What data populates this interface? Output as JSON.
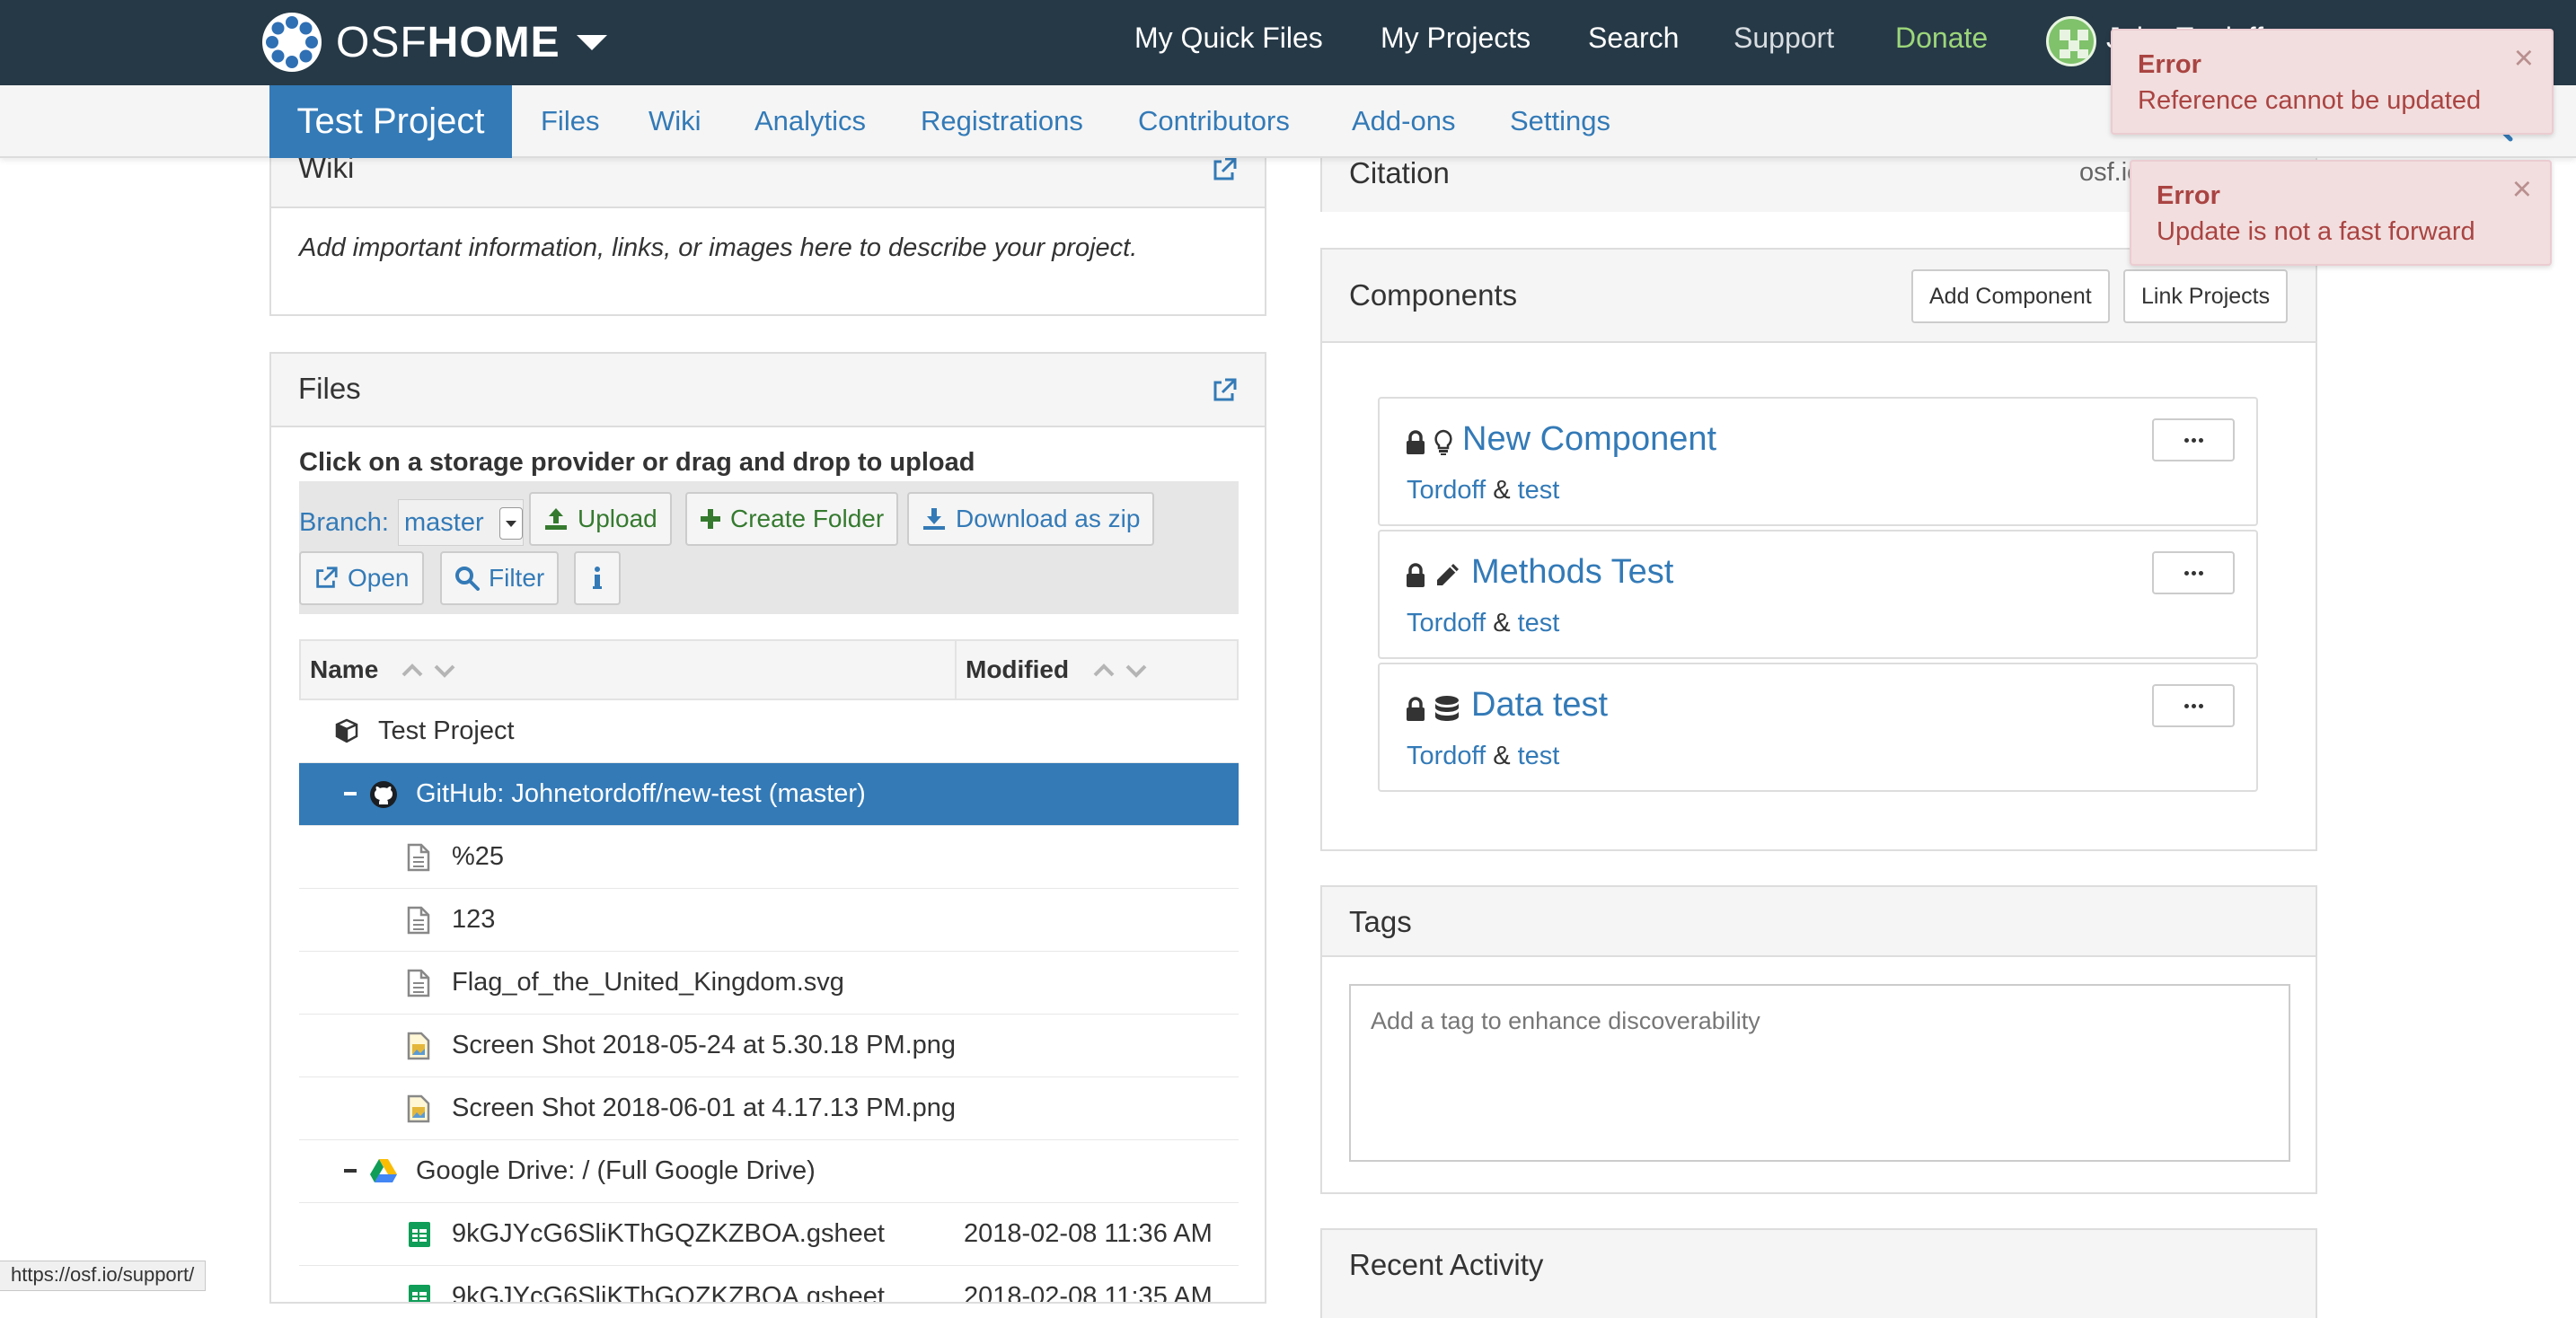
{
  "colors": {
    "navbar": "#263947",
    "primary": "#337ab7",
    "donate": "#9cd67a",
    "error_bg": "#f2dede",
    "error_text": "#a94442"
  },
  "navbar": {
    "brand_light": "OSF",
    "brand_bold": "HOME",
    "links": [
      "My Quick Files",
      "My Projects",
      "Search",
      "Support",
      "Donate"
    ],
    "user_name": "John Tordoff"
  },
  "project_nav": {
    "title": "Test Project",
    "tabs": [
      "Files",
      "Wiki",
      "Analytics",
      "Registrations",
      "Contributors",
      "Add-ons",
      "Settings"
    ]
  },
  "wiki": {
    "title": "Wiki",
    "placeholder_text": "Add important information, links, or images here to describe your project."
  },
  "files": {
    "title": "Files",
    "hint": "Click on a storage provider or drag and drop to upload",
    "branch_label": "Branch:",
    "branch_value": "master",
    "buttons": {
      "upload": "Upload",
      "create_folder": "Create Folder",
      "download_zip": "Download as zip",
      "open": "Open",
      "filter": "Filter"
    },
    "columns": {
      "name": "Name",
      "modified": "Modified"
    },
    "rows": [
      {
        "name": "Test Project",
        "modified": "",
        "icon": "cube-icon"
      },
      {
        "name": "GitHub: Johnetordoff/new-test (master)",
        "modified": "",
        "icon": "github-icon"
      },
      {
        "name": "%25",
        "modified": "",
        "icon": "file-icon"
      },
      {
        "name": "123",
        "modified": "",
        "icon": "file-icon"
      },
      {
        "name": "Flag_of_the_United_Kingdom.svg",
        "modified": "",
        "icon": "file-icon"
      },
      {
        "name": "Screen Shot 2018-05-24 at 5.30.18 PM.png",
        "modified": "",
        "icon": "image-file-icon"
      },
      {
        "name": "Screen Shot 2018-06-01 at 4.17.13 PM.png",
        "modified": "",
        "icon": "image-file-icon"
      },
      {
        "name": "Google Drive: / (Full Google Drive)",
        "modified": "",
        "icon": "google-drive-icon"
      },
      {
        "name": "9kGJYcG6SliKThGQZKZBOA.gsheet",
        "modified": "2018-02-08 11:36 AM",
        "icon": "spreadsheet-icon"
      },
      {
        "name": "9kGJYcG6SliKThGQZKZBOA.gsheet",
        "modified": "2018-02-08 11:35 AM",
        "icon": "spreadsheet-icon"
      }
    ]
  },
  "citation": {
    "title": "Citation",
    "url": "osf.io/"
  },
  "components": {
    "title": "Components",
    "add_button": "Add Component",
    "link_button": "Link Projects",
    "items": [
      {
        "title": "New Component",
        "contributor1": "Tordoff",
        "amp": "&",
        "contributor2": "test",
        "category_icon": "lightbulb-icon"
      },
      {
        "title": "Methods Test",
        "contributor1": "Tordoff",
        "amp": "&",
        "contributor2": "test",
        "category_icon": "pencil-icon"
      },
      {
        "title": "Data test",
        "contributor1": "Tordoff",
        "amp": "&",
        "contributor2": "test",
        "category_icon": "database-icon"
      }
    ]
  },
  "tags": {
    "title": "Tags",
    "placeholder": "Add a tag to enhance discoverability"
  },
  "activity": {
    "title": "Recent Activity"
  },
  "toasts": [
    {
      "title": "Error",
      "message": "Reference cannot be updated",
      "close": "×"
    },
    {
      "title": "Error",
      "message": "Update is not a fast forward",
      "close": "×"
    }
  ],
  "status_url": "https://osf.io/support/"
}
